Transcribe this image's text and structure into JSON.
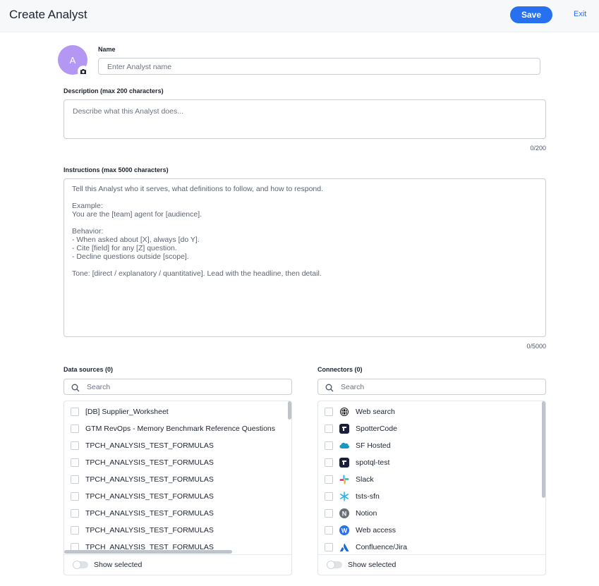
{
  "header": {
    "title": "Create Analyst",
    "save_label": "Save",
    "exit_label": "Exit"
  },
  "avatar": {
    "initial": "A",
    "color": "#b496f3"
  },
  "name_field": {
    "label": "Name",
    "placeholder": "Enter Analyst name"
  },
  "description": {
    "label": "Description (max 200 characters)",
    "placeholder": "Describe what this Analyst does...",
    "counter": "0/200"
  },
  "instructions": {
    "label": "Instructions (max 5000 characters)",
    "placeholder": "Tell this Analyst who it serves, what definitions to follow, and how to respond.\n\nExample:\nYou are the [team] agent for [audience].\n\nBehavior:\n- When asked about [X], always [do Y].\n- Cite [field] for any [Z] question.\n- Decline questions outside [scope].\n\nTone: [direct / explanatory / quantitative]. Lead with the headline, then detail.",
    "counter": "0/5000"
  },
  "data_sources": {
    "label": "Data sources (0)",
    "search_placeholder": "Search",
    "items": [
      "[DB] Supplier_Worksheet",
      "GTM RevOps - Memory Benchmark Reference Questions",
      "TPCH_ANALYSIS_TEST_FORMULAS",
      "TPCH_ANALYSIS_TEST_FORMULAS",
      "TPCH_ANALYSIS_TEST_FORMULAS",
      "TPCH_ANALYSIS_TEST_FORMULAS",
      "TPCH_ANALYSIS_TEST_FORMULAS",
      "TPCH_ANALYSIS_TEST_FORMULAS",
      "TPCH_ANALYSIS_TEST_FORMULAS"
    ],
    "show_selected_label": "Show selected"
  },
  "connectors": {
    "label": "Connectors (0)",
    "search_placeholder": "Search",
    "items": [
      {
        "label": "Web search",
        "icon": "globe-icon"
      },
      {
        "label": "SpotterCode",
        "icon": "spottercode-icon"
      },
      {
        "label": "SF Hosted",
        "icon": "salesforce-cloud-icon"
      },
      {
        "label": "spotql-test",
        "icon": "spottercode-icon"
      },
      {
        "label": "Slack",
        "icon": "slack-icon"
      },
      {
        "label": "tsts-sfn",
        "icon": "snowflake-icon"
      },
      {
        "label": "Notion",
        "icon": "notion-icon"
      },
      {
        "label": "Web access",
        "icon": "web-access-icon"
      },
      {
        "label": "Confluence/Jira",
        "icon": "atlassian-icon"
      }
    ],
    "show_selected_label": "Show selected"
  },
  "colors": {
    "accent": "#2770ef",
    "header_bg": "#f6f8fa"
  }
}
